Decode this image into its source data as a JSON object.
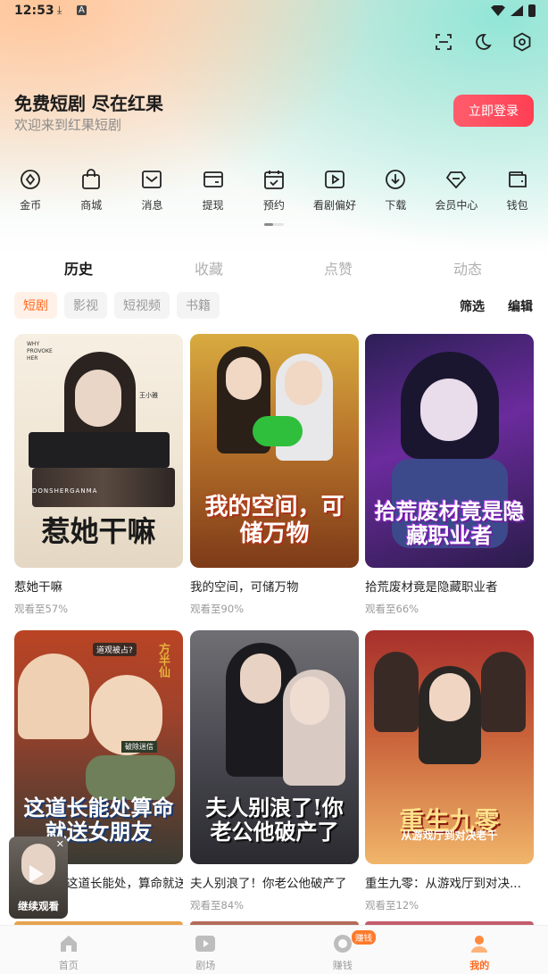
{
  "status_bar": {
    "time": "12:53"
  },
  "header": {
    "slogan": "免费短剧 尽在红果",
    "welcome": "欢迎来到红果短剧",
    "login_button": "立即登录",
    "top_icons": [
      "scan-icon",
      "moon-icon",
      "settings-icon"
    ]
  },
  "quick_menu": [
    {
      "label": "金币",
      "icon": "coin-icon"
    },
    {
      "label": "商城",
      "icon": "shopping-bag-icon"
    },
    {
      "label": "消息",
      "icon": "message-icon"
    },
    {
      "label": "提现",
      "icon": "withdraw-icon"
    },
    {
      "label": "预约",
      "icon": "calendar-icon"
    },
    {
      "label": "看剧偏好",
      "icon": "play-preference-icon"
    },
    {
      "label": "下载",
      "icon": "download-icon"
    },
    {
      "label": "会员中心",
      "icon": "diamond-icon"
    },
    {
      "label": "钱包",
      "icon": "wallet-icon"
    }
  ],
  "tabs": [
    {
      "label": "历史",
      "active": true
    },
    {
      "label": "收藏",
      "active": false
    },
    {
      "label": "点赞",
      "active": false
    },
    {
      "label": "动态",
      "active": false
    }
  ],
  "chips": [
    {
      "label": "短剧",
      "active": true
    },
    {
      "label": "影视",
      "active": false
    },
    {
      "label": "短视频",
      "active": false
    },
    {
      "label": "书籍",
      "active": false
    }
  ],
  "actions": {
    "filter": "筛选",
    "edit": "编辑"
  },
  "cards": [
    {
      "cover_title": "惹她干嘛",
      "name": "惹她干嘛",
      "progress": "观看至57%",
      "cover_tags": [
        "WHY",
        "PROVOKE",
        "HER",
        "王小雅",
        "DONSHERGANMA"
      ]
    },
    {
      "cover_title": "我的空间，可储万物",
      "name": "我的空间，可储万物",
      "progress": "观看至90%"
    },
    {
      "cover_title": "拾荒废材竟是隐藏职业者",
      "name": "拾荒废材竟是隐藏职业者",
      "progress": "观看至66%"
    },
    {
      "cover_title": "这道长能处算命就送女朋友",
      "name": "这道长能处，算命就送女朋友",
      "progress": "",
      "cover_tags": [
        "道观被占?",
        "方半仙",
        "破除迷信"
      ]
    },
    {
      "cover_title": "夫人别浪了!你老公他破产了",
      "name": "夫人别浪了！你老公他破产了",
      "progress": "观看至84%"
    },
    {
      "cover_title": "重生九零",
      "name": "重生九零：从游戏厅到对决...",
      "progress": "观看至12%",
      "cover_subtitle": "从游戏厅到对决老千"
    }
  ],
  "float_player": {
    "label": "继续观看"
  },
  "bottom_nav": [
    {
      "label": "首页",
      "icon": "home-icon",
      "active": false
    },
    {
      "label": "剧场",
      "icon": "theater-icon",
      "active": false
    },
    {
      "label": "赚钱",
      "icon": "earn-icon",
      "active": false,
      "badge": "赚钱"
    },
    {
      "label": "我的",
      "icon": "profile-icon",
      "active": true
    }
  ],
  "colors": {
    "accent": "#ff6a1f",
    "login": "#ff4a5c"
  }
}
